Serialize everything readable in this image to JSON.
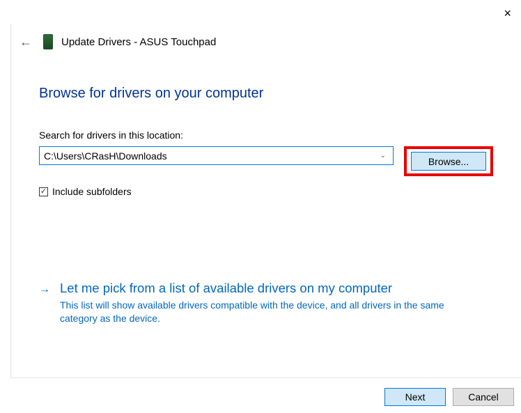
{
  "window": {
    "close_label": "×"
  },
  "header": {
    "back_glyph": "←",
    "title": "Update Drivers - ASUS Touchpad"
  },
  "heading": "Browse for drivers on your computer",
  "search": {
    "label": "Search for drivers in this location:",
    "path": "C:\\Users\\CRasH\\Downloads",
    "browse_label": "Browse...",
    "include_subfolders_label": "Include subfolders",
    "include_subfolders_checked": true
  },
  "pick": {
    "arrow_glyph": "→",
    "title": "Let me pick from a list of available drivers on my computer",
    "description": "This list will show available drivers compatible with the device, and all drivers in the same category as the device."
  },
  "footer": {
    "next_label": "Next",
    "cancel_label": "Cancel"
  }
}
